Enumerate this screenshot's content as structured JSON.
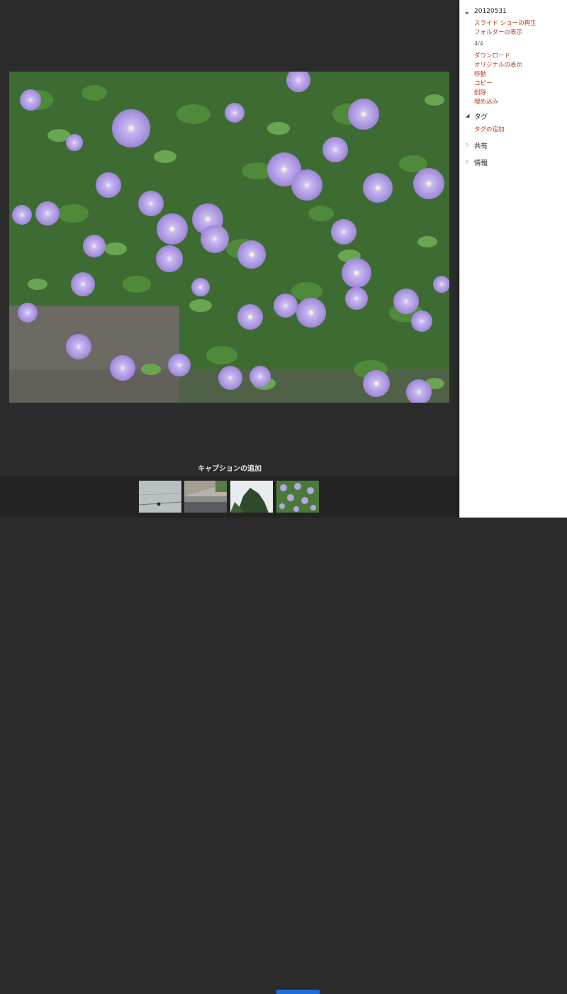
{
  "album": {
    "date": "20120531",
    "slideshow_label": "スライド ショーの再生",
    "folder_label": "フォルダーの表示"
  },
  "photo": {
    "counter": "4/4",
    "actions": [
      "ダウンロード",
      "オリジナルの表示",
      "移動",
      "コピー",
      "削除",
      "埋め込み"
    ]
  },
  "tags": {
    "heading": "タグ",
    "add_label": "タグの追加"
  },
  "share": {
    "heading": "共有"
  },
  "info": {
    "heading": "情報"
  },
  "viewer": {
    "caption_placeholder": "キャプションの追加"
  },
  "filmstrip": {
    "selected_index": 4,
    "count": 4
  },
  "colors": {
    "link": "#b5401d",
    "viewer_bg": "#2b2b2b",
    "selection": "#1d6ed8"
  }
}
